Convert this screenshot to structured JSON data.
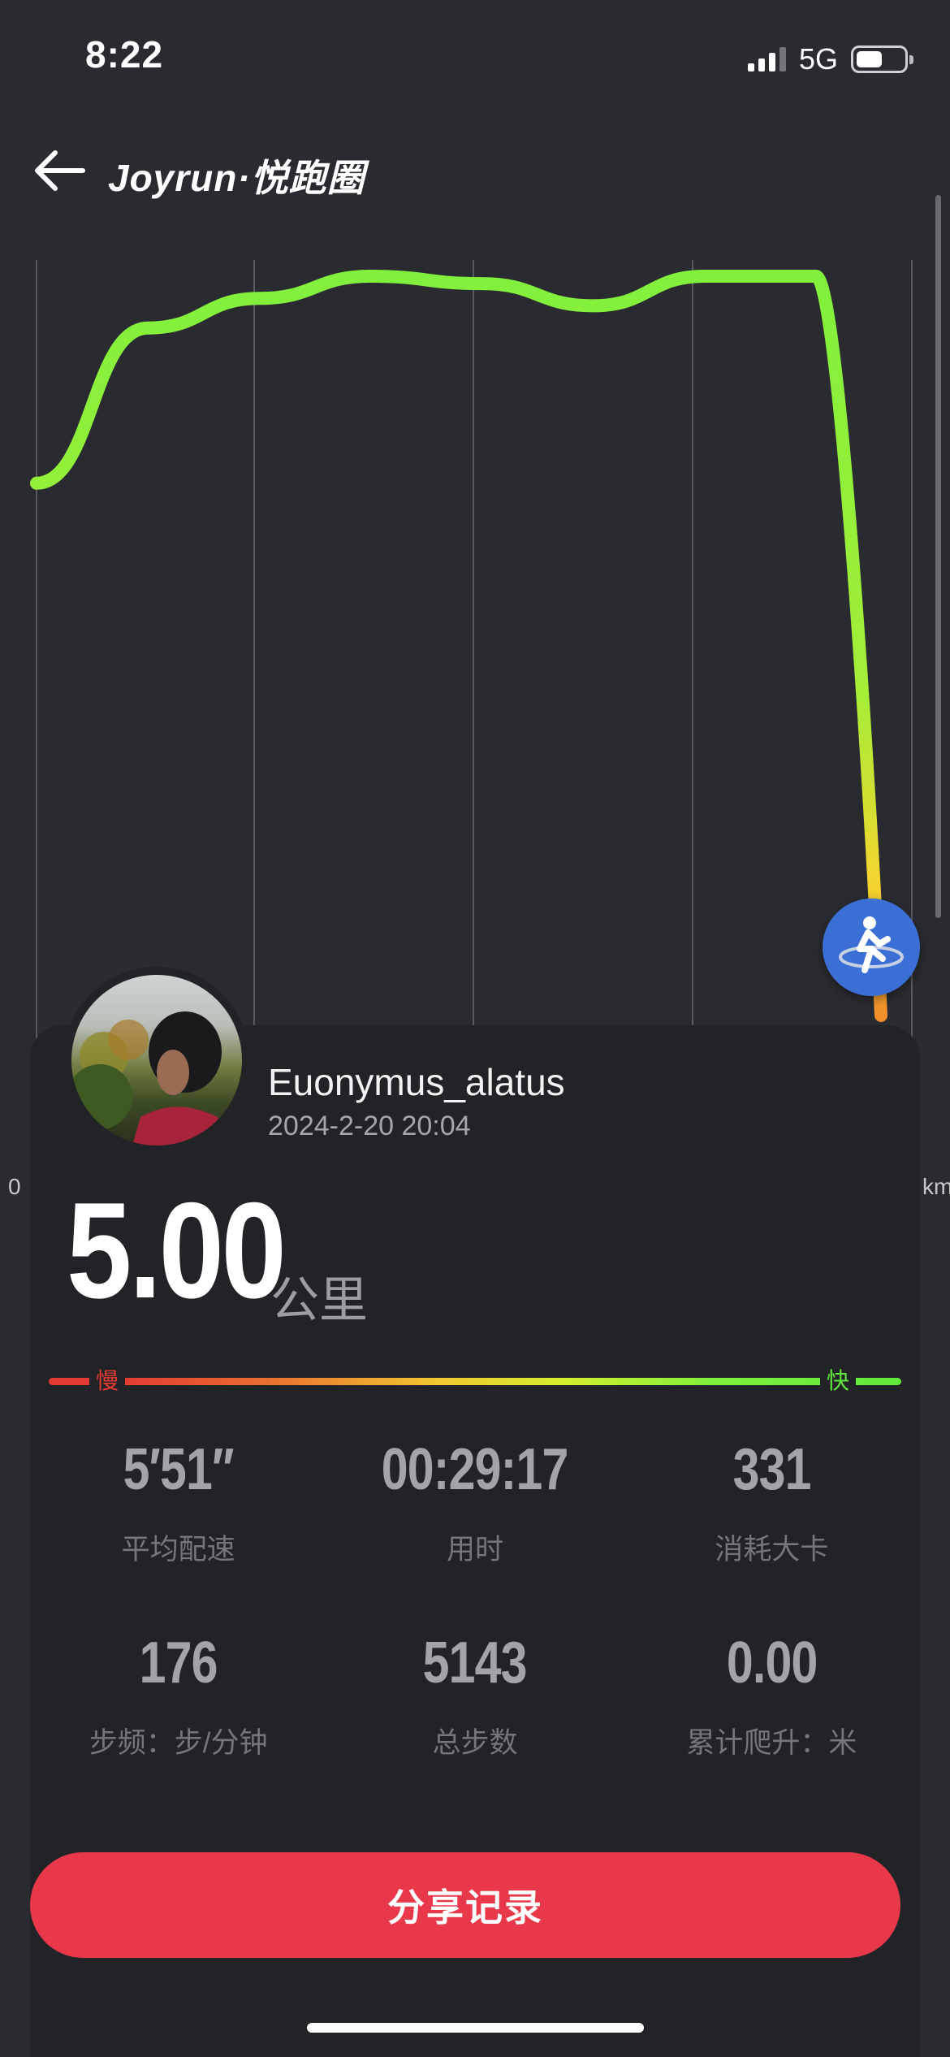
{
  "status_bar": {
    "time": "8:22",
    "network": "5G",
    "battery_level": 0.55
  },
  "nav": {
    "title": "Joyrun·悦跑圈",
    "back_icon": "arrow-left-icon"
  },
  "chart_data": {
    "type": "line",
    "title": "",
    "xlabel": "",
    "ylabel": "",
    "x_tick_labels": [
      "0",
      "km"
    ],
    "grid": "vertical",
    "series": [
      {
        "values": [
          0.72,
          0.93,
          0.97,
          1.0,
          0.99,
          0.96,
          1.0,
          1.0,
          0.0
        ]
      }
    ],
    "colors": [
      "#7ef03c",
      "#f2c530",
      "#f07b2a"
    ]
  },
  "map_button_icon": "runner-icon",
  "profile": {
    "username": "Euonymus_alatus",
    "date": "2024-2-20 20:04"
  },
  "distance": {
    "value": "5.00",
    "unit": "公里"
  },
  "pace_legend": {
    "slow": "慢",
    "fast": "快"
  },
  "stats": [
    {
      "value": "5′51′′",
      "label": "平均配速"
    },
    {
      "value": "00:29:17",
      "label": "用时"
    },
    {
      "value": "331",
      "label": "消耗大卡"
    },
    {
      "value": "176",
      "label": "步频：步/分钟"
    },
    {
      "value": "5143",
      "label": "总步数"
    },
    {
      "value": "0.00",
      "label": "累计爬升：米"
    }
  ],
  "share_button": {
    "label": "分享记录"
  }
}
